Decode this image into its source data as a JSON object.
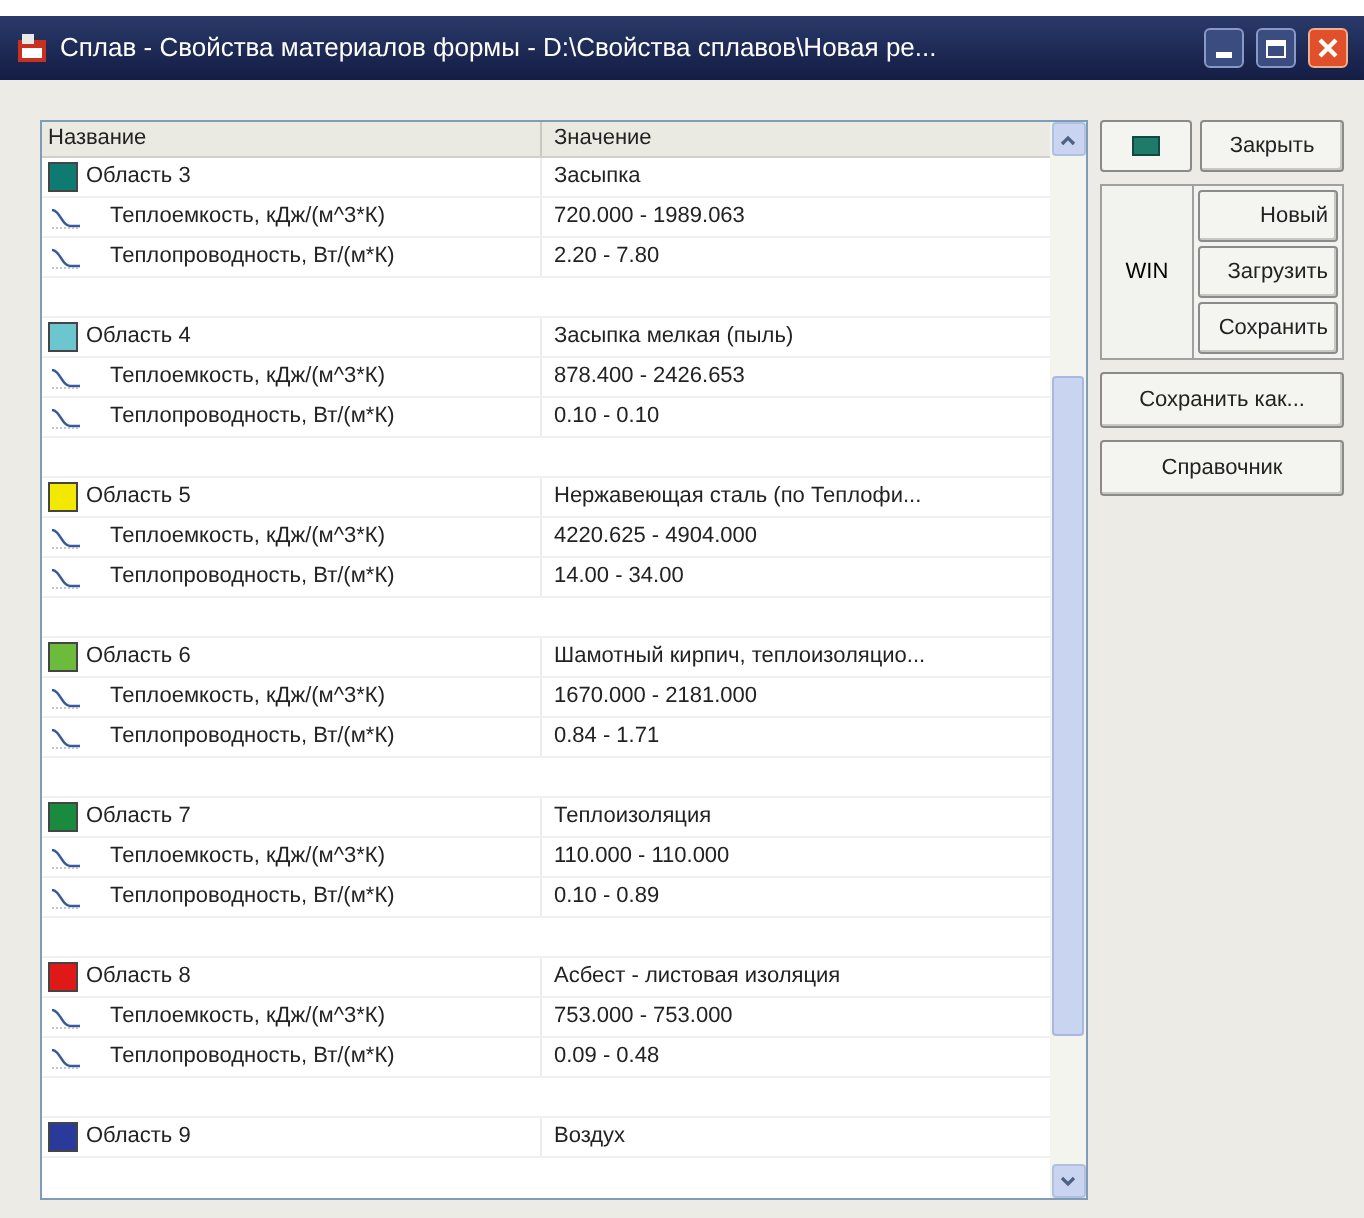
{
  "window": {
    "title": "Сплав - Свойства материалов формы - D:\\Свойства сплавов\\Новая ре..."
  },
  "table": {
    "columns": [
      "Название",
      "Значение"
    ],
    "areas": [
      {
        "name": "Область 3",
        "color": "#0f7a70",
        "material": "Засыпка",
        "properties": [
          {
            "name": "Теплоемкость, кДж/(м^3*К)",
            "value": "720.000 - 1989.063"
          },
          {
            "name": "Теплопроводность, Вт/(м*К)",
            "value": "2.20 - 7.80"
          }
        ]
      },
      {
        "name": "Область 4",
        "color": "#6cc6d0",
        "material": "Засыпка мелкая (пыль)",
        "properties": [
          {
            "name": "Теплоемкость, кДж/(м^3*К)",
            "value": "878.400 - 2426.653"
          },
          {
            "name": "Теплопроводность, Вт/(м*К)",
            "value": "0.10 - 0.10"
          }
        ]
      },
      {
        "name": "Область 5",
        "color": "#f2e800",
        "material": "Нержавеющая сталь (по Теплофи...",
        "properties": [
          {
            "name": "Теплоемкость, кДж/(м^3*К)",
            "value": "4220.625 - 4904.000"
          },
          {
            "name": "Теплопроводность, Вт/(м*К)",
            "value": "14.00 - 34.00"
          }
        ]
      },
      {
        "name": "Область 6",
        "color": "#6cbb3c",
        "material": "Шамотный кирпич, теплоизоляцио...",
        "properties": [
          {
            "name": "Теплоемкость, кДж/(м^3*К)",
            "value": "1670.000 - 2181.000"
          },
          {
            "name": "Теплопроводность, Вт/(м*К)",
            "value": "0.84 - 1.71"
          }
        ]
      },
      {
        "name": "Область 7",
        "color": "#1a8a3e",
        "material": "Теплоизоляция",
        "properties": [
          {
            "name": "Теплоемкость, кДж/(м^3*К)",
            "value": "110.000 - 110.000"
          },
          {
            "name": "Теплопроводность, Вт/(м*К)",
            "value": "0.10 - 0.89"
          }
        ]
      },
      {
        "name": "Область 8",
        "color": "#e01818",
        "material": "Асбест - листовая изоляция",
        "properties": [
          {
            "name": "Теплоемкость, кДж/(м^3*К)",
            "value": "753.000 - 753.000"
          },
          {
            "name": "Теплопроводность, Вт/(м*К)",
            "value": "0.09 - 0.48"
          }
        ]
      },
      {
        "name": "Область 9",
        "color": "#2a3a9a",
        "material": "Воздух"
      }
    ]
  },
  "buttons": {
    "close": "Закрыть",
    "group_label": "WIN",
    "group": [
      "Новый",
      "Загрузить",
      "Сохранить"
    ],
    "save_as": "Сохранить как...",
    "reference": "Справочник"
  }
}
